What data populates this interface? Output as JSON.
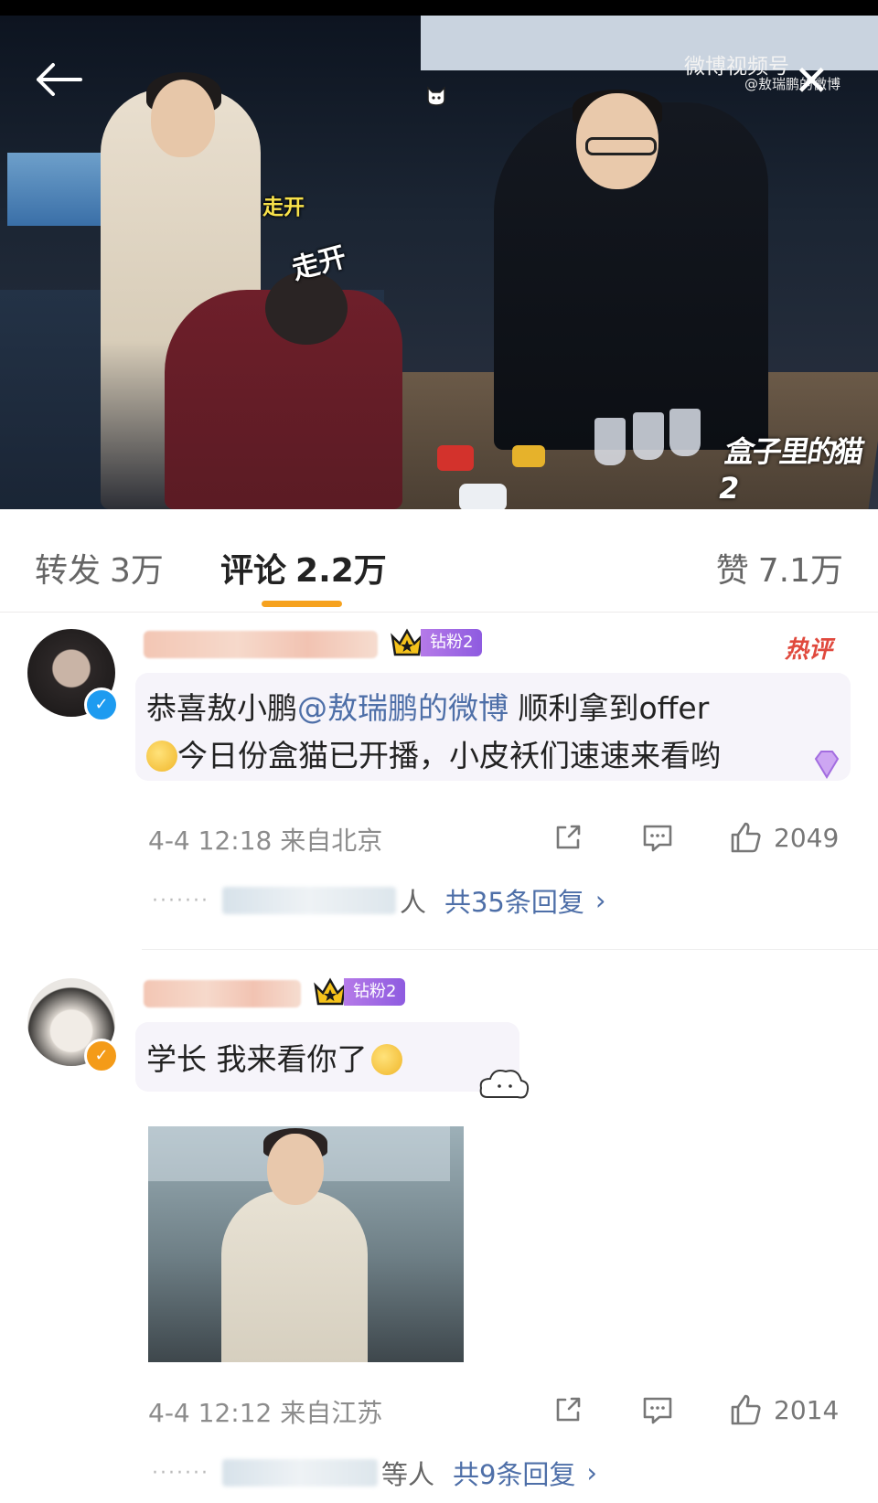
{
  "video": {
    "watermark": "微博视频号",
    "watermark_sub": "@敖瑞鹏的微博",
    "sticker_small": "走开",
    "sticker_large": "走开",
    "show_logo": "盒子里的猫2"
  },
  "tabs": {
    "repost": {
      "label": "转发",
      "count": "3万"
    },
    "comment": {
      "label": "评论",
      "count": "2.2万"
    },
    "like": {
      "label": "赞",
      "count": "7.1万"
    }
  },
  "comments": [
    {
      "badge": "钻粉2",
      "hot_tag": "热评",
      "text_line1_pre": "恭喜敖小鹏",
      "mention": "@敖瑞鹏的微博",
      "text_line1_post": " 顺利拿到offer",
      "text_line2": "今日份盒猫已开播，小皮袄们速速来看哟",
      "meta": "4-4 12:18 来自北京",
      "likes": "2049",
      "reply_tail": "人",
      "reply_count": "共35条回复",
      "reply_chevron": "›"
    },
    {
      "badge": "钻粉2",
      "text_line1": "学长 我来看你了",
      "meta": "4-4 12:12 来自江苏",
      "likes": "2014",
      "reply_tail": "等人",
      "reply_count": "共9条回复",
      "reply_chevron": "›"
    }
  ]
}
